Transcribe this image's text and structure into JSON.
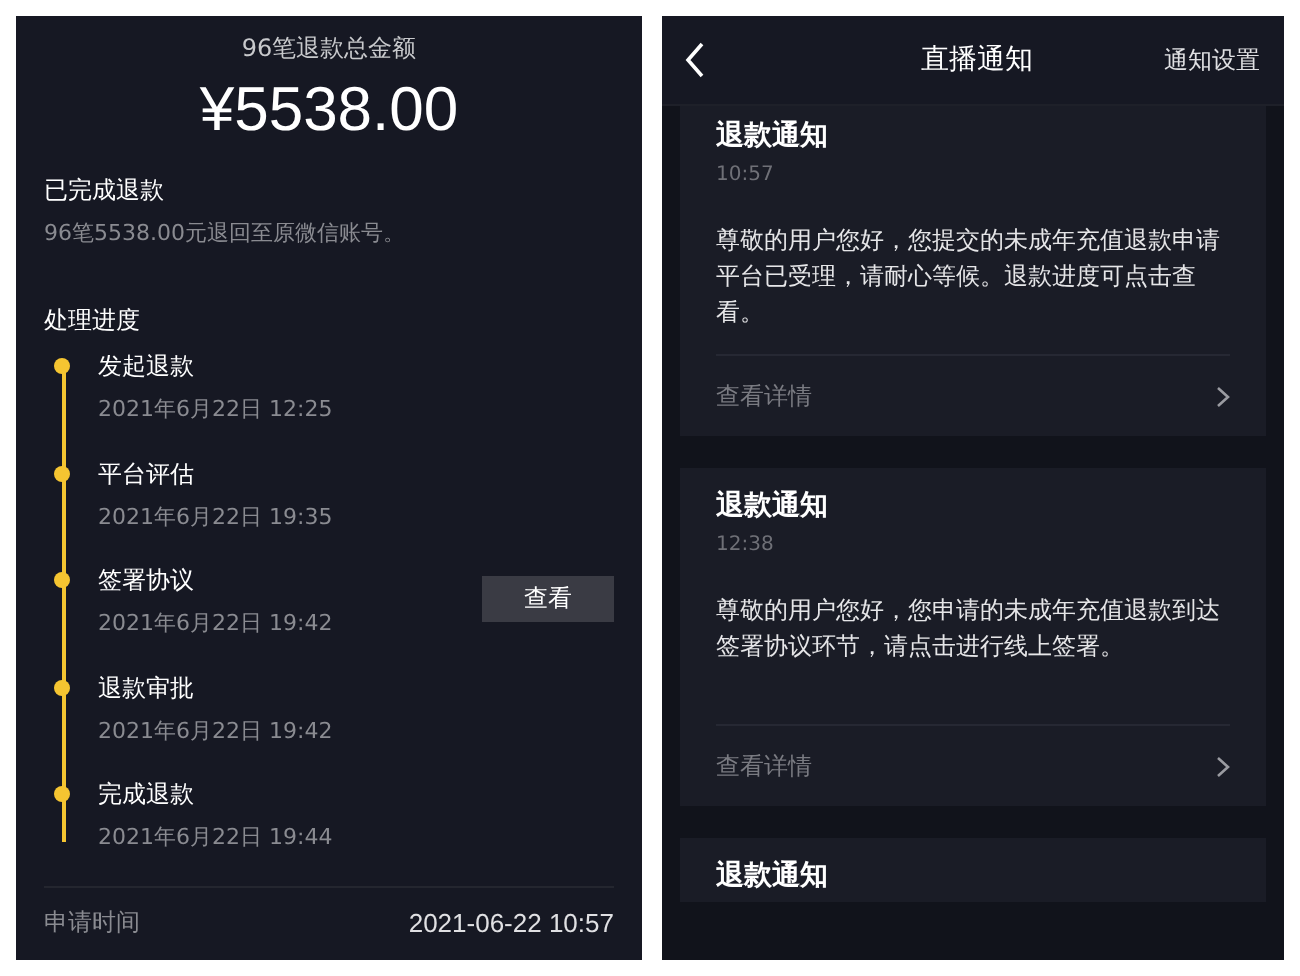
{
  "refund_screen": {
    "total_label": "96笔退款总金额",
    "total_amount": "¥5538.00",
    "status_title": "已完成退款",
    "status_detail": "96笔5538.00元退回至原微信账号。",
    "progress_title": "处理进度",
    "steps": [
      {
        "name": "发起退款",
        "time": "2021年6月22日 12:25"
      },
      {
        "name": "平台评估",
        "time": "2021年6月22日 19:35"
      },
      {
        "name": "签署协议",
        "time": "2021年6月22日 19:42",
        "action": "查看"
      },
      {
        "name": "退款审批",
        "time": "2021年6月22日 19:42"
      },
      {
        "name": "完成退款",
        "time": "2021年6月22日 19:44"
      }
    ],
    "footer": {
      "label": "申请时间",
      "value": "2021-06-22 10:57"
    }
  },
  "notice_screen": {
    "title": "直播通知",
    "settings_link": "通知设置",
    "cards": [
      {
        "title": "退款通知",
        "time": "10:57",
        "body": "尊敬的用户您好，您提交的未成年充值退款申请平台已受理，请耐心等候。退款进度可点击查看。",
        "link": "查看详情"
      },
      {
        "title": "退款通知",
        "time": "12:38",
        "body": "尊敬的用户您好，您申请的未成年充值退款到达签署协议环节，请点击进行线上签署。",
        "link": "查看详情"
      },
      {
        "title": "退款通知"
      }
    ]
  }
}
